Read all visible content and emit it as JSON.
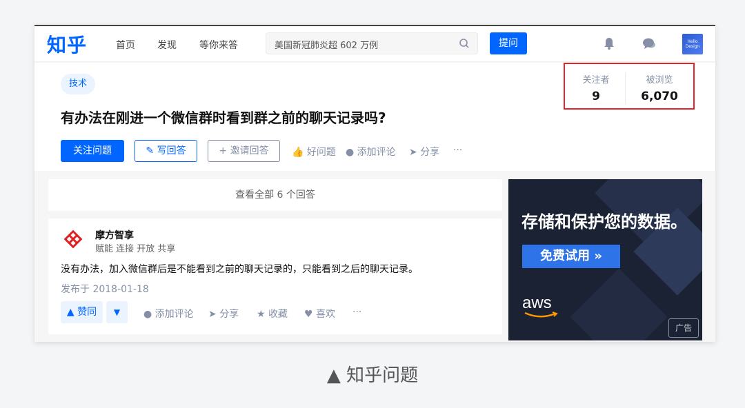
{
  "topbar": {
    "logo": "知乎",
    "nav": [
      "首页",
      "发现",
      "等你来答"
    ],
    "search_value": "美国新冠肺炎超 602 万例",
    "ask_label": "提问",
    "avatar_text": "Hello Design"
  },
  "question": {
    "tag": "技术",
    "title": "有办法在刚进一个微信群时看到群之前的聊天记录吗?",
    "followers_label": "关注者",
    "followers_value": "9",
    "views_label": "被浏览",
    "views_value": "6,070",
    "buttons": {
      "follow": "关注问题",
      "write": "写回答",
      "invite": "邀请回答",
      "good": "好问题",
      "comment": "添加评论",
      "share": "分享",
      "more": "···"
    }
  },
  "answers": {
    "view_all": "查看全部 6 个回答",
    "item": {
      "author_name": "摩方智享",
      "author_bio": "赋能 连接 开放 共享",
      "text": "没有办法，加入微信群后是不能看到之前的聊天记录的，只能看到之后的聊天记录。",
      "date": "发布于 2018-01-18",
      "vote_up": "赞同",
      "actions": {
        "comment": "添加评论",
        "share": "分享",
        "collect": "收藏",
        "like": "喜欢",
        "more": "···"
      }
    }
  },
  "ad": {
    "title": "存储和保护您的数据。",
    "button": "免费试用 »",
    "brand": "aws",
    "badge": "广告"
  },
  "caption": "▲ 知乎问题"
}
